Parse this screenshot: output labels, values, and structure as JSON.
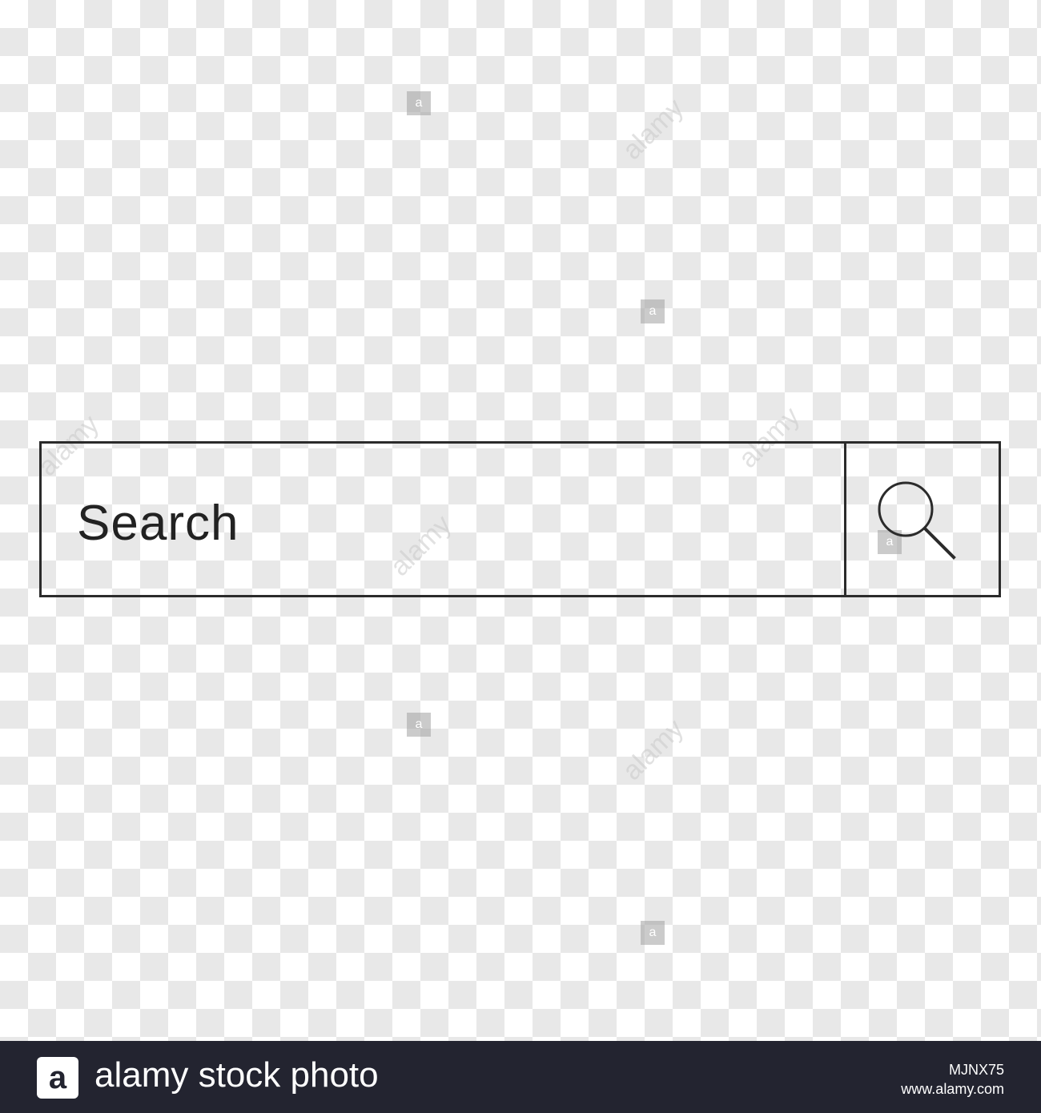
{
  "search": {
    "placeholder": "Search",
    "button_icon": "search-icon"
  },
  "watermark": {
    "tile_letter": "a",
    "brand_text": "alamy"
  },
  "footer": {
    "logo_letter": "a",
    "title": "alamy stock photo",
    "image_id": "MJNX75",
    "site": "www.alamy.com"
  },
  "colors": {
    "canvas_light": "#ffffff",
    "canvas_dark": "#e8e8e8",
    "stroke": "#2b2b2b",
    "footer_bg": "#232430"
  }
}
